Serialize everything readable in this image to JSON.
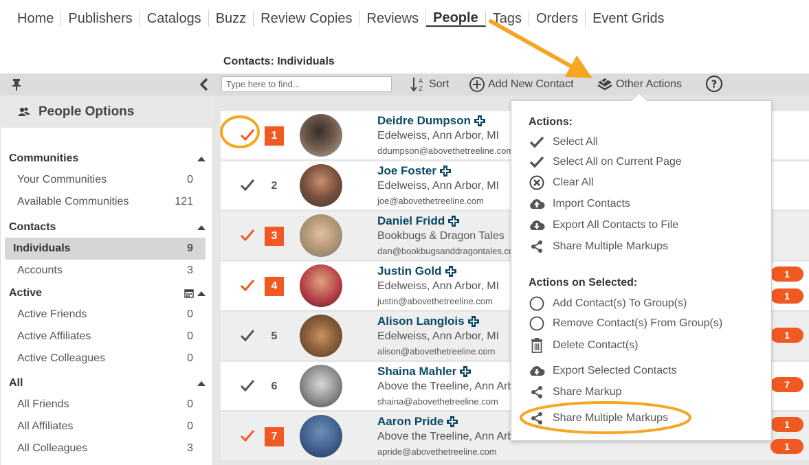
{
  "nav": {
    "items": [
      "Home",
      "Publishers",
      "Catalogs",
      "Buzz",
      "Review Copies",
      "Reviews",
      "People",
      "Tags",
      "Orders",
      "Event Grids"
    ]
  },
  "section_label": "Contacts: Individuals",
  "toolbar": {
    "search_placeholder": "Type here to find...",
    "sort_label": "Sort",
    "add_label": "Add New Contact",
    "other_label": "Other Actions"
  },
  "sidebar": {
    "title": "People Options",
    "groups": [
      {
        "label": "Communities",
        "items": [
          {
            "label": "Your Communities",
            "count": "0"
          },
          {
            "label": "Available Communities",
            "count": "121"
          }
        ]
      },
      {
        "label": "Contacts",
        "items": [
          {
            "label": "Individuals",
            "count": "9"
          },
          {
            "label": "Accounts",
            "count": "3"
          }
        ]
      },
      {
        "label": "Active",
        "items": [
          {
            "label": "Active Friends",
            "count": "0"
          },
          {
            "label": "Active Affiliates",
            "count": "0"
          },
          {
            "label": "Active Colleagues",
            "count": "0"
          }
        ]
      },
      {
        "label": "All",
        "items": [
          {
            "label": "All Friends",
            "count": "0"
          },
          {
            "label": "All Affiliates",
            "count": "0"
          },
          {
            "label": "All Colleagues",
            "count": "3"
          }
        ]
      }
    ]
  },
  "contacts": [
    {
      "num": "1",
      "name": "Deidre Dumpson",
      "org": "Edelweiss, Ann Arbor, MI",
      "email": "ddumpson@abovethetreeline.com",
      "selected": true
    },
    {
      "num": "2",
      "name": "Joe Foster",
      "org": "Edelweiss, Ann Arbor, MI",
      "email": "joe@abovethetreeline.com",
      "selected": false
    },
    {
      "num": "3",
      "name": "Daniel Fridd",
      "org": "Bookbugs & Dragon Tales",
      "email": "dan@bookbugsanddragontales.com",
      "selected": true
    },
    {
      "num": "4",
      "name": "Justin Gold",
      "org": "Edelweiss, Ann Arbor, MI",
      "email": "justin@abovethetreeline.com",
      "selected": true
    },
    {
      "num": "5",
      "name": "Alison Langlois",
      "org": "Edelweiss, Ann Arbor, MI",
      "email": "alison@abovethetreeline.com",
      "selected": false
    },
    {
      "num": "6",
      "name": "Shaina Mahler",
      "org": "Above the Treeline, Ann Arbor, MI",
      "email": "shaina@abovethetreeline.com",
      "selected": false
    },
    {
      "num": "7",
      "name": "Aaron Pride",
      "org": "Above the Treeline, Ann Arbor, MI",
      "email": "apride@abovethetreeline.com",
      "selected": true
    }
  ],
  "badges": [
    "1",
    "1",
    "1",
    "7",
    "1",
    "1"
  ],
  "dropdown": {
    "actions_title": "Actions:",
    "actions": [
      "Select All",
      "Select All on Current Page",
      "Clear All",
      "Import Contacts",
      "Export All Contacts to File",
      "Share Multiple Markups"
    ],
    "selected_title": "Actions on Selected:",
    "selected_actions": [
      "Add Contact(s) To Group(s)",
      "Remove Contact(s) From Group(s)",
      "Delete Contact(s)",
      "Export Selected Contacts",
      "Share Markup",
      "Share Multiple Markups"
    ]
  },
  "colors": {
    "accent_orange": "#f05a22",
    "annotation_orange": "#f5a623",
    "name_blue": "#0b4866",
    "toolbar_gray": "#dcdcdc"
  }
}
